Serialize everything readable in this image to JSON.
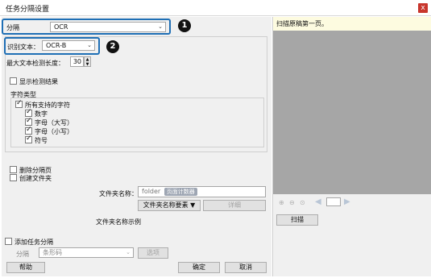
{
  "window": {
    "title": "任务分隔设置",
    "close_glyph": "x"
  },
  "callouts": {
    "one": "1",
    "two": "2"
  },
  "separation": {
    "label": "分隔",
    "value": "OCR"
  },
  "recognize": {
    "label": "识别文本：",
    "value": "OCR-B"
  },
  "max_length": {
    "label": "最大文本检测长度：",
    "value": "30"
  },
  "show_results": {
    "label": "显示检测结果",
    "checked": false
  },
  "charset": {
    "group_label": "字符类型",
    "all_label": "所有支持的字符",
    "items": [
      {
        "label": "数字",
        "checked": true
      },
      {
        "label": "字母（大写）",
        "checked": true
      },
      {
        "label": "字母（小写）",
        "checked": true
      },
      {
        "label": "符号",
        "checked": true
      }
    ]
  },
  "delete_page": {
    "label": "删除分隔页",
    "checked": false
  },
  "create_folder": {
    "label": "创建文件夹",
    "checked": false
  },
  "folder_name": {
    "label": "文件夹名称：",
    "value": "folder",
    "chip": "页面计数器"
  },
  "folder_buttons": {
    "elements": "文件夹名称要素 ▼",
    "detail": "详细"
  },
  "folder_example": {
    "label": "文件夹名称示例"
  },
  "add_separation": {
    "label": "添加任务分隔",
    "checked": false
  },
  "add_sep_row": {
    "label": "分隔",
    "value": "条形码",
    "options_button": "选项"
  },
  "footer": {
    "help": "帮助",
    "ok": "确定",
    "cancel": "取消"
  },
  "preview": {
    "message": "扫描原稿第一页。",
    "scan_button": "扫描",
    "icons": [
      "zoom-in-icon",
      "zoom-out-icon",
      "fit-icon",
      "prev-arrow-icon",
      "next-arrow-icon"
    ]
  },
  "colors": {
    "callout": "#1f6fb5",
    "badge": "#111111",
    "preview_bg": "#a6a6a6",
    "info_bg": "#fdfbe0",
    "close_bg": "#c8362d"
  }
}
